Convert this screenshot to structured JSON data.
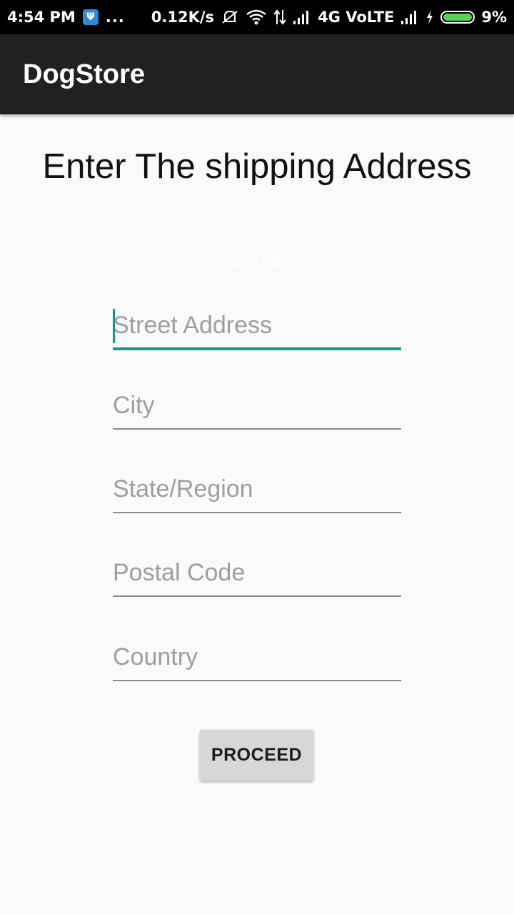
{
  "status_bar": {
    "time": "4:54 PM",
    "dots": "...",
    "speed": "0.12K/s",
    "network": "4G VoLTE",
    "battery": "9%",
    "battery_level": 0.09
  },
  "app_bar": {
    "title": "DogStore"
  },
  "heading": "Enter The shipping Address",
  "textview": "TextView",
  "form": {
    "street_placeholder": "Street Address",
    "city_placeholder": "City",
    "state_placeholder": "State/Region",
    "postal_placeholder": "Postal Code",
    "country_placeholder": "Country"
  },
  "proceed_label": "PROCEED",
  "colors": {
    "accent": "#1a9288",
    "app_bar": "#212121",
    "background": "#fafafa",
    "button": "#d6d7d7"
  }
}
